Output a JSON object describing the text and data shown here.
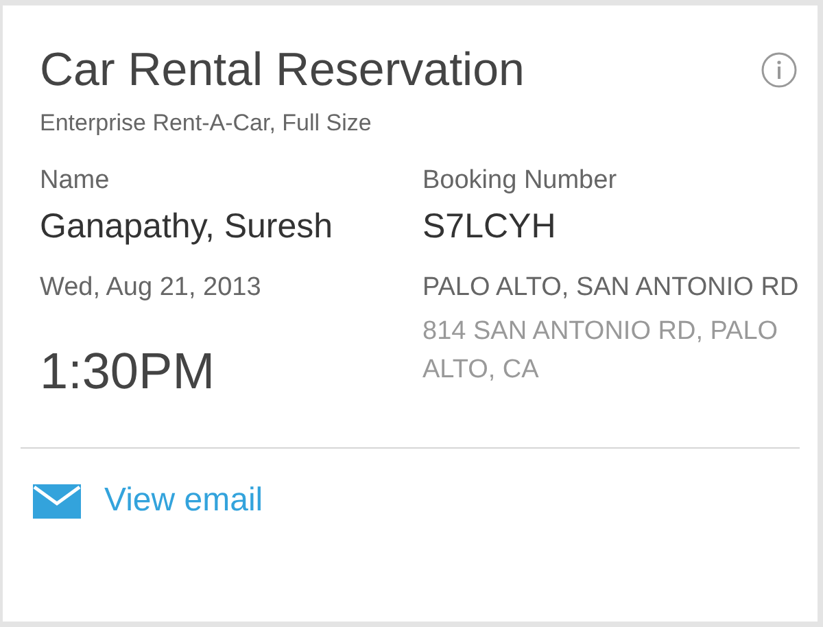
{
  "card": {
    "title": "Car Rental Reservation",
    "subtitle": "Enterprise Rent-A-Car, Full Size",
    "name_label": "Name",
    "name": "Ganapathy, Suresh",
    "booking_label": "Booking Number",
    "booking_number": "S7LCYH",
    "date": "Wed, Aug 21, 2013",
    "time": "1:30PM",
    "location": "PALO ALTO, SAN ANTONIO RD",
    "address": "814 SAN ANTONIO RD, PALO ALTO, CA",
    "action": "View email"
  }
}
